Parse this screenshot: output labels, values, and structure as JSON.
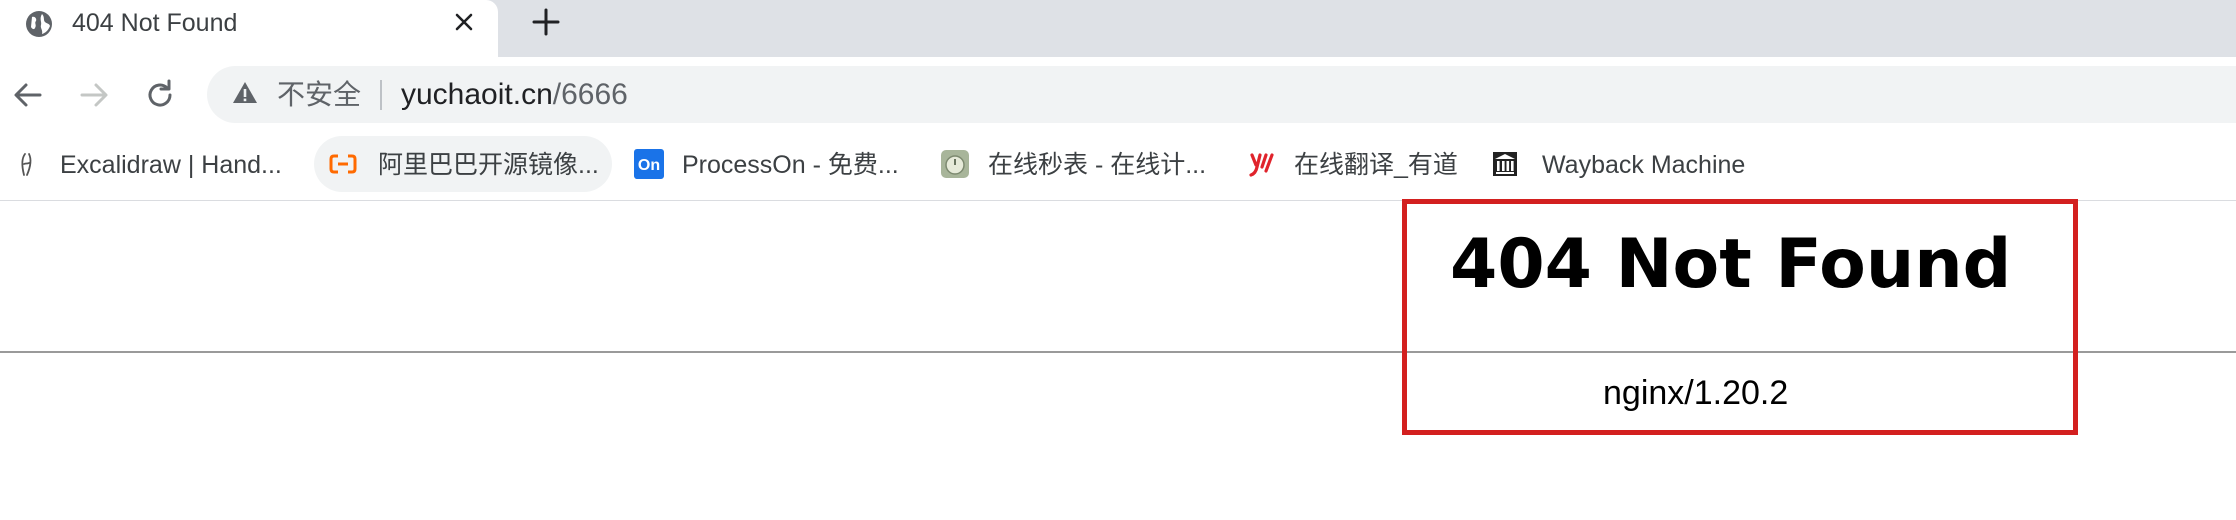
{
  "tab": {
    "title": "404 Not Found"
  },
  "toolbar": {
    "security_label": "不安全",
    "url_host": "yuchaoit.cn",
    "url_path": "/6666"
  },
  "bookmarks": [
    {
      "label": "Excalidraw | Hand...",
      "icon": "excalidraw-icon"
    },
    {
      "label": "阿里巴巴开源镜像...",
      "icon": "alibaba-cloud-icon"
    },
    {
      "label": "ProcessOn - 免费...",
      "icon": "processon-icon"
    },
    {
      "label": "在线秒表 - 在线计...",
      "icon": "stopwatch-icon"
    },
    {
      "label": "在线翻译_有道",
      "icon": "youdao-icon"
    },
    {
      "label": "Wayback Machine",
      "icon": "wayback-icon"
    }
  ],
  "page": {
    "heading": "404 Not Found",
    "server": "nginx/1.20.2"
  },
  "colors": {
    "highlight": "#d3201f",
    "alibaba": "#ff6a00",
    "processon": "#1a73e8",
    "youdao": "#e0242c"
  }
}
